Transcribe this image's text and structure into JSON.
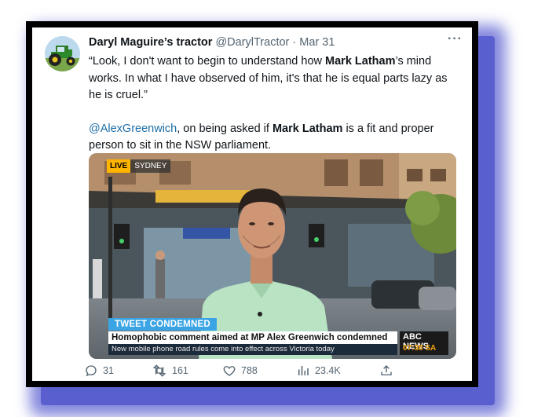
{
  "tweet": {
    "display_name": "Daryl Maguire’s tractor",
    "handle": "@DarylTractor",
    "separator": "·",
    "date": "Mar 31",
    "more": "···",
    "p1": {
      "q1": "“Look, I don't want to begin to understand how ",
      "name1": "Mark Latham",
      "q2": "’s mind works. In what I have observed of him, it's that he is equal parts lazy as he is cruel.”"
    },
    "p2": {
      "mention": "@AlexGreenwich",
      "t1": ", on being asked if ",
      "name2": "Mark Latham",
      "t2": " is a fit and proper person to sit in the NSW parliament."
    }
  },
  "media": {
    "live_tag": "LIVE",
    "city": "SYDNEY",
    "badge": "TWEET CONDEMNED",
    "headline": "Homophobic comment aimed at MP Alex Greenwich condemned",
    "brand": "ABC NEWS",
    "time": "07:38",
    "tz": "SA",
    "ticker": "New mobile phone road rules come into effect across Victoria today"
  },
  "actions": {
    "replies": "31",
    "retweets": "161",
    "likes": "788",
    "views": "23.4K"
  },
  "colors": {
    "accent": "#1d6ea8",
    "shadow": "#5a5fd0",
    "badge": "#3aa4e4",
    "live": "#ffb400"
  }
}
